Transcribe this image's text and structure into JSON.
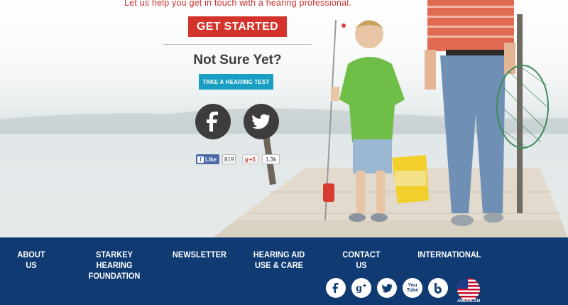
{
  "hero": {
    "tagline": "Let us help you get in touch with a hearing professional.",
    "get_started_label": "GET STARTED",
    "not_sure_heading": "Not Sure Yet?",
    "hearing_test_label": "TAKE A HEARING TEST",
    "facebook_icon": "facebook-icon",
    "twitter_icon": "twitter-icon",
    "fb_like": {
      "label": "Like",
      "count": "819"
    },
    "gplus": {
      "label": "+1",
      "count": "1.3k"
    }
  },
  "footer": {
    "nav": [
      {
        "label": "ABOUT US"
      },
      {
        "label": "STARKEY HEARING FOUNDATION"
      },
      {
        "label": "NEWSLETTER"
      },
      {
        "label": "HEARING AID USE & CARE"
      },
      {
        "label": "CONTACT US"
      },
      {
        "label": "INTERNATIONAL"
      }
    ],
    "social_icons": [
      "facebook-icon",
      "google-plus-icon",
      "twitter-icon",
      "youtube-icon",
      "blog-icon"
    ],
    "youtube_text": "You Tube",
    "flag_caption": "AMERICAN"
  },
  "colors": {
    "cta_red": "#d4332b",
    "tagline_red": "#c62d2d",
    "test_blue": "#199fc3",
    "footer_navy": "#0f3a72",
    "social_dark": "#3d3d3d"
  }
}
